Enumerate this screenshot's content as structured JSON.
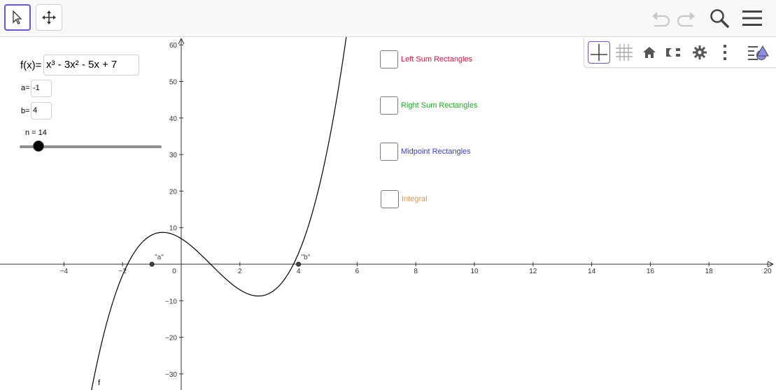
{
  "toolbar": {
    "tools": [
      {
        "name": "Move",
        "icon": "pointer-arrow-icon",
        "active": true
      },
      {
        "name": "Move Graphics View",
        "icon": "four-way-arrows-icon",
        "active": false
      }
    ],
    "right_icons": [
      "undo-icon",
      "redo-icon",
      "search-icon",
      "hamburger-menu-icon"
    ]
  },
  "style_bar": {
    "icons": [
      "axes-toggle-icon",
      "grid-toggle-icon",
      "home-icon",
      "magnet-icon",
      "gear-icon",
      "more-vertical-icon",
      "algebra-view-toggle-icon"
    ]
  },
  "algebra": {
    "function_label": "f(x)=",
    "function_value": "x³ - 3x² - 5x + 7",
    "a_label": "a=",
    "a_value": "-1",
    "b_label": "b=",
    "b_value": "4",
    "slider_label": "n = 14",
    "slider": {
      "min": 1,
      "max": 100,
      "value": 14
    }
  },
  "checkboxes": [
    {
      "label": "Left Sum Rectangles",
      "color": "#d4143e",
      "checked": false
    },
    {
      "label": "Right Sum Rectangles",
      "color": "#1ab01a",
      "checked": false
    },
    {
      "label": "Midpoint Rectangles",
      "color": "#3c3cc8",
      "checked": false
    },
    {
      "label": "Integral",
      "color": "#e8954a",
      "checked": false
    }
  ],
  "graph": {
    "x_ticks": [
      -4,
      -2,
      0,
      2,
      4,
      6,
      8,
      10,
      12,
      14,
      16,
      18,
      20
    ],
    "y_ticks": [
      -30,
      -20,
      -10,
      10,
      20,
      30,
      40,
      50,
      60
    ],
    "curve_label": "f",
    "points": [
      {
        "label": "\"a\"",
        "x": -1,
        "y": 0
      },
      {
        "label": "\"b\"",
        "x": 4,
        "y": 0
      }
    ],
    "function": "x^3 - 3x^2 - 5x + 7"
  }
}
